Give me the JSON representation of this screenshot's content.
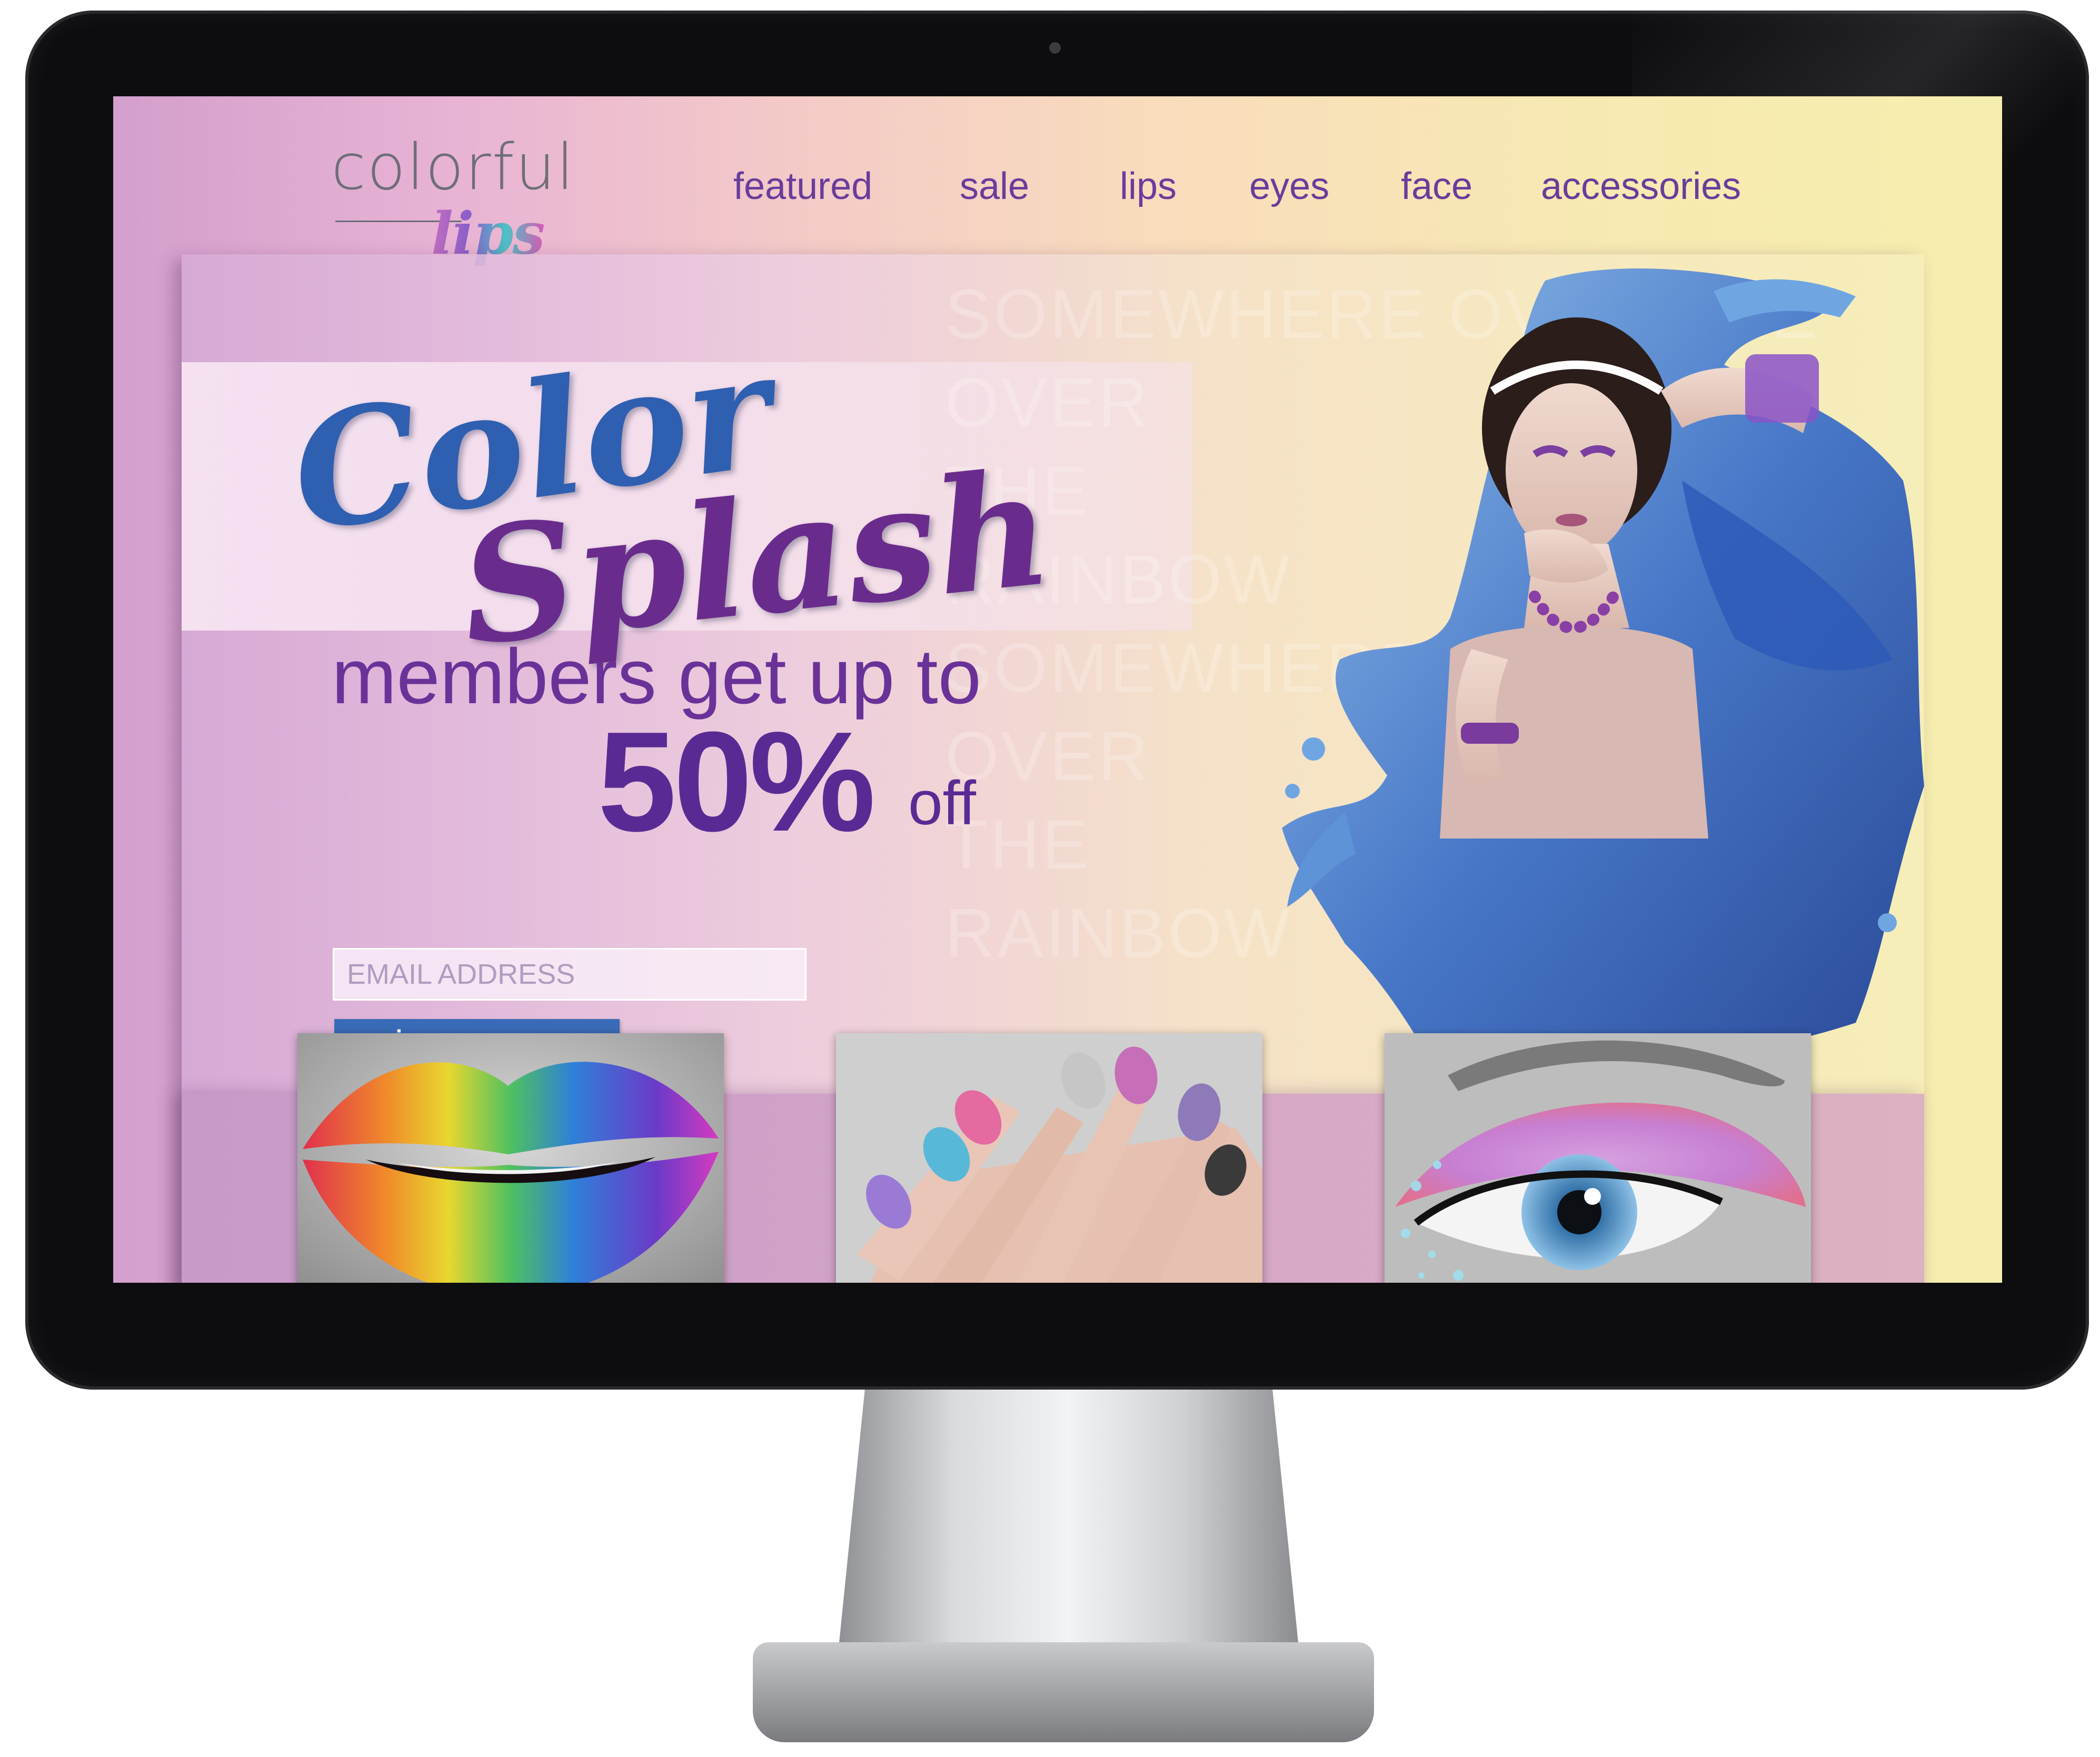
{
  "brand": {
    "logo_word": "colorful",
    "logo_script": "lips"
  },
  "nav": {
    "items": [
      "featured",
      "sale",
      "lips",
      "eyes",
      "face",
      "accessories"
    ]
  },
  "hero": {
    "background_words": "SOMEWHERE OVER THE\nOVER\nTHE\nRAINBOW\nSOMEWHERE\nOVER\nTHE\nRAINBOW",
    "title_line1": "Color",
    "title_line2": "Splash",
    "promo_line": "members get up to",
    "promo_percent": "50%",
    "promo_off": "off"
  },
  "signup": {
    "email_placeholder": "EMAIL ADDRESS",
    "button_label": "sign up now"
  },
  "tiles": [
    {
      "name": "rainbow lips"
    },
    {
      "name": "pastel nails"
    },
    {
      "name": "pastel eye makeup"
    }
  ],
  "colors": {
    "nav_text": "#6a3c9c",
    "title_blue": "#2f5fb0",
    "title_purple": "#6a2c8c",
    "button": "#3a6bb8"
  }
}
